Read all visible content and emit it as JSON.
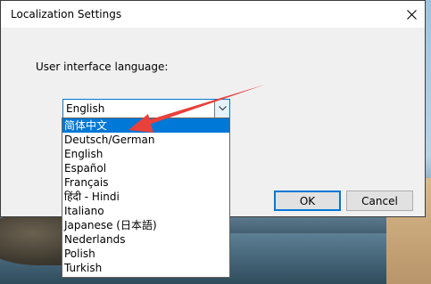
{
  "dialog": {
    "title": "Localization Settings",
    "close_icon": "close-icon",
    "language_label": "User interface language:",
    "combo_value": "English",
    "ok_label": "OK",
    "cancel_label": "Cancel"
  },
  "dropdown": {
    "options": [
      "简体中文",
      "Deutsch/German",
      "English",
      "Español",
      "Français",
      "हिंदी - Hindi",
      "Italiano",
      "Japanese (日本語)",
      "Nederlands",
      "Polish",
      "Turkish"
    ],
    "highlighted_index": 0
  },
  "colors": {
    "accent": "#0078d7",
    "annotation": "#e8413b",
    "dialog_bg": "#f0f0f0"
  }
}
